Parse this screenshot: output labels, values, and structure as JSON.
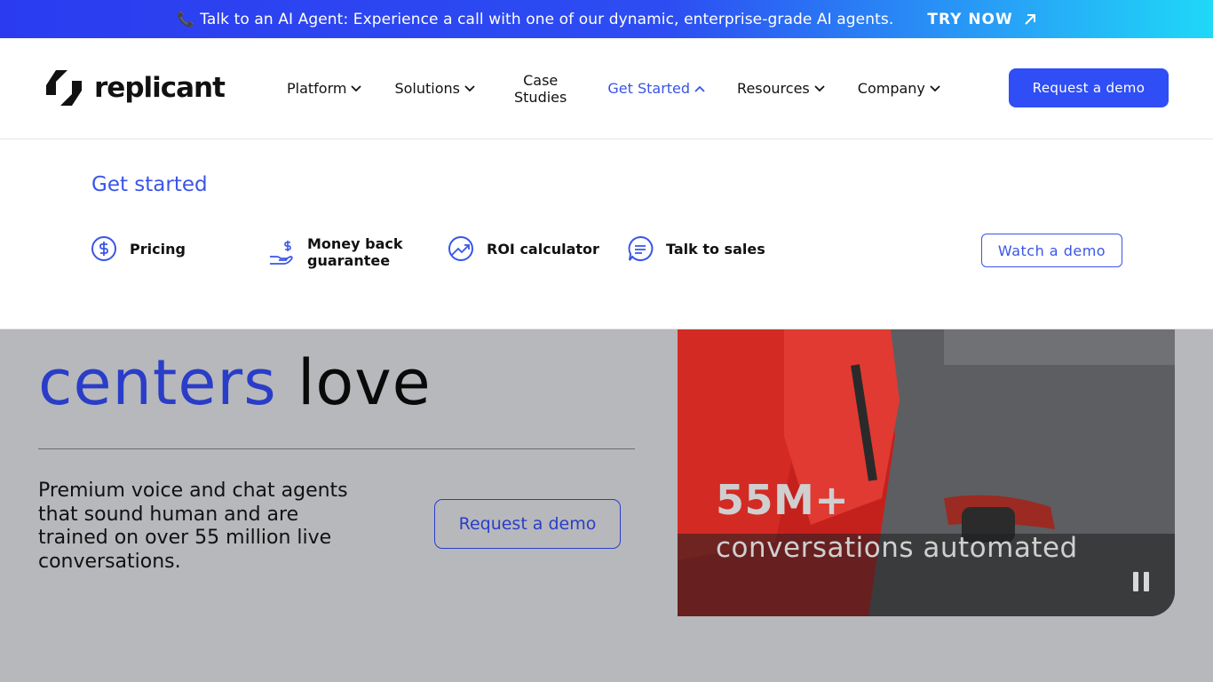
{
  "announcement": {
    "icon": "phone-icon",
    "message": "Talk to an AI Agent: Experience a call with one of our dynamic, enterprise-grade AI agents.",
    "cta_label": "TRY NOW"
  },
  "header": {
    "logo_text": "replicant",
    "nav": [
      {
        "label": "Platform"
      },
      {
        "label": "Solutions"
      },
      {
        "label_line1": "Case",
        "label_line2": "Studies"
      },
      {
        "label": "Get Started"
      },
      {
        "label": "Resources"
      },
      {
        "label": "Company"
      }
    ],
    "cta_label": "Request a demo"
  },
  "dropdown": {
    "title": "Get started",
    "items": [
      {
        "label": "Pricing",
        "icon": "dollar-icon"
      },
      {
        "label_line1": "Money back",
        "label_line2": "guarantee",
        "icon": "hand-money-icon"
      },
      {
        "label": "ROI calculator",
        "icon": "trend-icon"
      },
      {
        "label": "Talk to sales",
        "icon": "chat-icon"
      }
    ],
    "watch_label": "Watch a demo"
  },
  "hero": {
    "headline_blue": "centers",
    "headline_black": "love",
    "subtext": "Premium voice and chat agents that sound human and are trained on over 55 million live conversations.",
    "button_label": "Request a demo"
  },
  "media": {
    "stat": "55M+",
    "stat_label": "conversations automated"
  },
  "colors": {
    "accent": "#2f4ef5",
    "accent_text": "#3a55e8"
  }
}
